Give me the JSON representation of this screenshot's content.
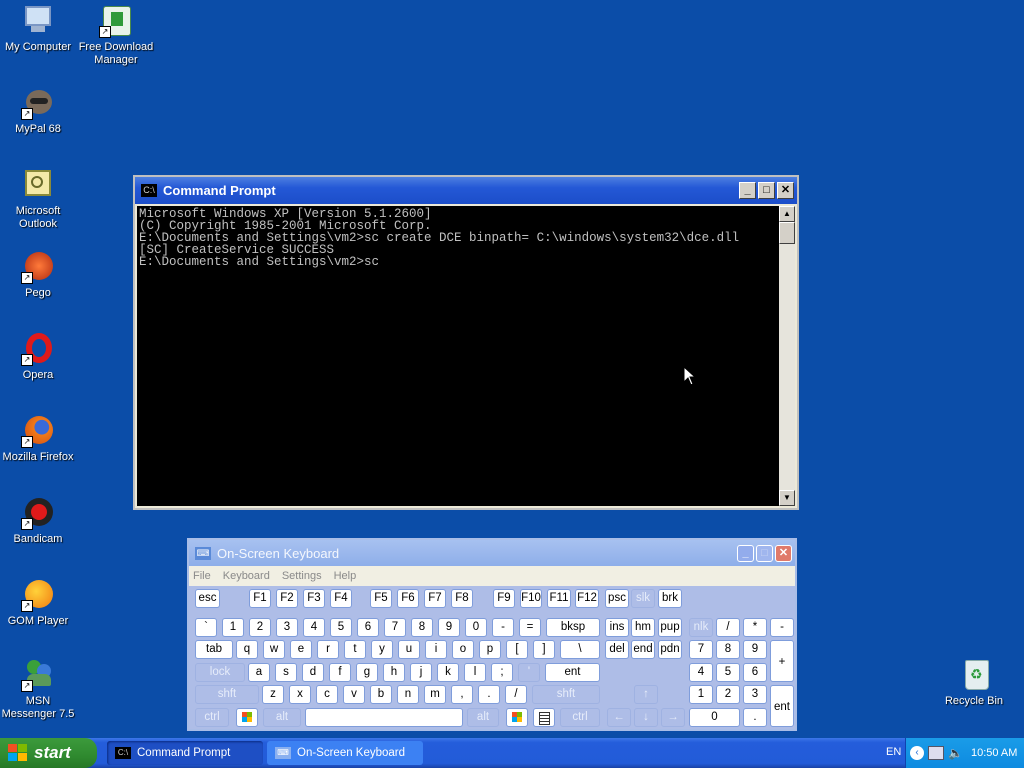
{
  "desktop": {
    "icons": [
      {
        "label": "My Computer"
      },
      {
        "label": "Free Download Manager"
      },
      {
        "label": "MyPal 68"
      },
      {
        "label": "Microsoft Outlook"
      },
      {
        "label": "Pego"
      },
      {
        "label": "Opera"
      },
      {
        "label": "Mozilla Firefox"
      },
      {
        "label": "Bandicam"
      },
      {
        "label": "GOM Player"
      },
      {
        "label": "MSN Messenger 7.5"
      },
      {
        "label": "Recycle Bin"
      }
    ]
  },
  "cmd_window": {
    "title": "Command Prompt",
    "icon_text": "C:\\",
    "lines": [
      "Microsoft Windows XP [Version 5.1.2600]",
      "(C) Copyright 1985-2001 Microsoft Corp.",
      "",
      "E:\\Documents and Settings\\vm2>sc create DCE binpath= C:\\windows\\system32\\dce.dll",
      "",
      "[SC] CreateService SUCCESS",
      "",
      "E:\\Documents and Settings\\vm2>sc"
    ]
  },
  "osk_window": {
    "title": "On-Screen Keyboard",
    "menu": [
      "File",
      "Keyboard",
      "Settings",
      "Help"
    ],
    "keys": {
      "esc": "esc",
      "f1": "F1",
      "f2": "F2",
      "f3": "F3",
      "f4": "F4",
      "f5": "F5",
      "f6": "F6",
      "f7": "F7",
      "f8": "F8",
      "f9": "F9",
      "f10": "F10",
      "f11": "F11",
      "f12": "F12",
      "psc": "psc",
      "slk": "slk",
      "brk": "brk",
      "backtick": "`",
      "d1": "1",
      "d2": "2",
      "d3": "3",
      "d4": "4",
      "d5": "5",
      "d6": "6",
      "d7": "7",
      "d8": "8",
      "d9": "9",
      "d0": "0",
      "minus": "-",
      "equals": "=",
      "bksp": "bksp",
      "ins": "ins",
      "hm": "hm",
      "pup": "pup",
      "nlk": "nlk",
      "np_div": "/",
      "np_mul": "*",
      "np_sub": "-",
      "tab": "tab",
      "q": "q",
      "w": "w",
      "e": "e",
      "r": "r",
      "t": "t",
      "y": "y",
      "u": "u",
      "i": "i",
      "o": "o",
      "p": "p",
      "lbr": "[",
      "rbr": "]",
      "bslash": "\\",
      "del": "del",
      "end": "end",
      "pdn": "pdn",
      "np7": "7",
      "np8": "8",
      "np9": "9",
      "np_add": "+",
      "lock": "lock",
      "a": "a",
      "s": "s",
      "d": "d",
      "f": "f",
      "g": "g",
      "h": "h",
      "j": "j",
      "k": "k",
      "l": "l",
      "semi": ";",
      "quote": "'",
      "ent": "ent",
      "np4": "4",
      "np5": "5",
      "np6": "6",
      "lshft": "shft",
      "z": "z",
      "x": "x",
      "c": "c",
      "v": "v",
      "b": "b",
      "n": "n",
      "m": "m",
      "comma": ",",
      "period": ".",
      "slash": "/",
      "rshft": "shft",
      "up": "↑",
      "np1": "1",
      "np2": "2",
      "np3": "3",
      "np_ent": "ent",
      "lctrl": "ctrl",
      "lalt": "alt",
      "ralt": "alt",
      "rctrl": "ctrl",
      "left": "←",
      "down": "↓",
      "right": "→",
      "np0": "0",
      "np_dot": "."
    }
  },
  "taskbar": {
    "start_label": "start",
    "tasks": [
      {
        "label": "Command Prompt"
      },
      {
        "label": "On-Screen Keyboard"
      }
    ],
    "tray": {
      "lang": "EN",
      "clock": "10:50 AM"
    }
  }
}
